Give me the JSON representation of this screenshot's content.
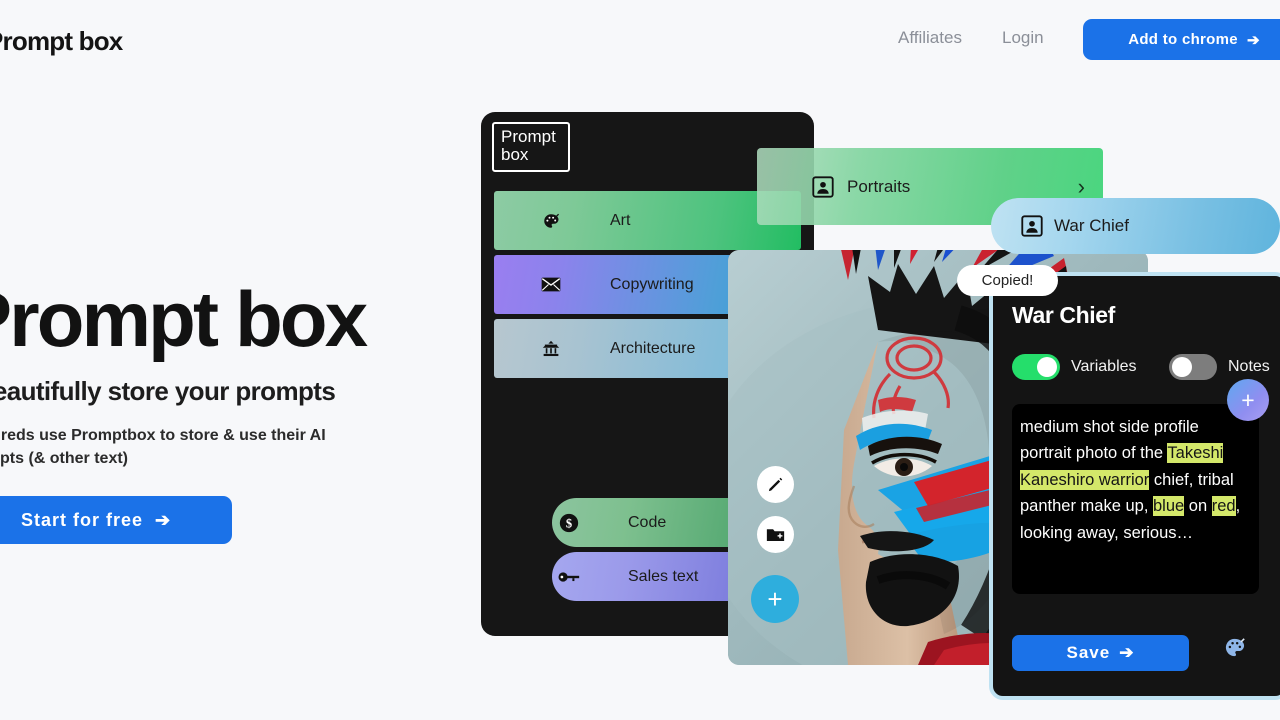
{
  "header": {
    "logo": "Prompt box",
    "nav": [
      {
        "id": "affiliates",
        "label": "Affiliates"
      },
      {
        "id": "login",
        "label": "Login"
      }
    ],
    "cta": {
      "label": "Add to chrome",
      "arrow": "➔",
      "color": "#1b72e8"
    }
  },
  "hero": {
    "title": "Prompt box",
    "subtitle": "- Beautifully store your prompts",
    "body": "Hundreds use Promptbox to store & use their AI prompts (& other text)",
    "cta": {
      "label": "Start for free",
      "arrow": "➔",
      "color": "#1b72e8"
    }
  },
  "app_panel": {
    "logo": "Prompt\nbox",
    "logo_line1": "Prompt",
    "logo_line2": "box",
    "background": "#161616",
    "categories": [
      {
        "id": "art",
        "label": "Art",
        "icon": "palette-icon",
        "glyph": "🎨",
        "shape": "rect",
        "gradient_from": "#8dcba4",
        "gradient_to": "#22bd62"
      },
      {
        "id": "copywriting",
        "label": "Copywriting",
        "icon": "envelope-icon",
        "glyph": "✉",
        "shape": "rect",
        "gradient_from": "#9a7ef0",
        "gradient_to": "#2a9fd3"
      },
      {
        "id": "architecture",
        "label": "Architecture",
        "icon": "temple-icon",
        "glyph": "⛩",
        "shape": "rect",
        "gradient_from": "#b7c7cf",
        "gradient_to": "#6eb9dd"
      },
      {
        "id": "code",
        "label": "Code",
        "icon": "dollar-icon",
        "glyph": "💲",
        "shape": "pill",
        "gradient_from": "#8cc49f",
        "gradient_to": "#3f9f63"
      },
      {
        "id": "sales",
        "label": "Sales text",
        "icon": "key-icon",
        "glyph": "🗝",
        "shape": "pill",
        "gradient_from": "#a5a7ef",
        "gradient_to": "#6f6ed6"
      }
    ],
    "actions": [
      {
        "id": "edit",
        "icon": "pencil-icon",
        "bg": "#ffffff"
      },
      {
        "id": "new-folder",
        "icon": "folder-plus-icon",
        "bg": "#ffffff"
      },
      {
        "id": "add",
        "icon": "plus-icon",
        "glyph": "+",
        "bg": "#2eaedd"
      }
    ]
  },
  "portraits_row": {
    "label": "Portraits",
    "icon": "portrait-icon",
    "chevron": "›",
    "gradient_from": "#afdcbe",
    "gradient_to": "#4ad67f"
  },
  "warchief_pill": {
    "label": "War Chief",
    "icon": "portrait-icon",
    "gradient_from": "#bfe2f2",
    "gradient_to": "#5fb4dd"
  },
  "tooltip": {
    "label": "Copied!"
  },
  "detail_panel": {
    "title": "War Chief",
    "border_color": "#bfe2f2",
    "toggles": [
      {
        "id": "variables",
        "label": "Variables",
        "state": "on",
        "color": "#25de6b"
      },
      {
        "id": "notes",
        "label": "Notes",
        "state": "off",
        "color": "#7d7d7d"
      }
    ],
    "add_button": {
      "icon": "plus-icon",
      "glyph": "+"
    },
    "prompt": {
      "segments": [
        {
          "text": "medium shot side profile portrait photo of the ",
          "highlight": false
        },
        {
          "text": "Takeshi Kaneshiro warrior",
          "highlight": true
        },
        {
          "text": " chief, tribal panther make up, ",
          "highlight": false
        },
        {
          "text": "blue",
          "highlight": true
        },
        {
          "text": " on ",
          "highlight": false
        },
        {
          "text": "red",
          "highlight": true
        },
        {
          "text": ", looking away, serious…",
          "highlight": false
        }
      ],
      "highlight_color": "#d4e86a"
    },
    "save": {
      "label": "Save",
      "arrow": "➔",
      "color": "#1b72e8"
    },
    "palette": {
      "icon": "palette-icon",
      "glyph": "🎨"
    }
  },
  "portrait_image": {
    "description": "side profile portrait of a warrior chief with blue and red tribal face paint and feather headdress"
  }
}
